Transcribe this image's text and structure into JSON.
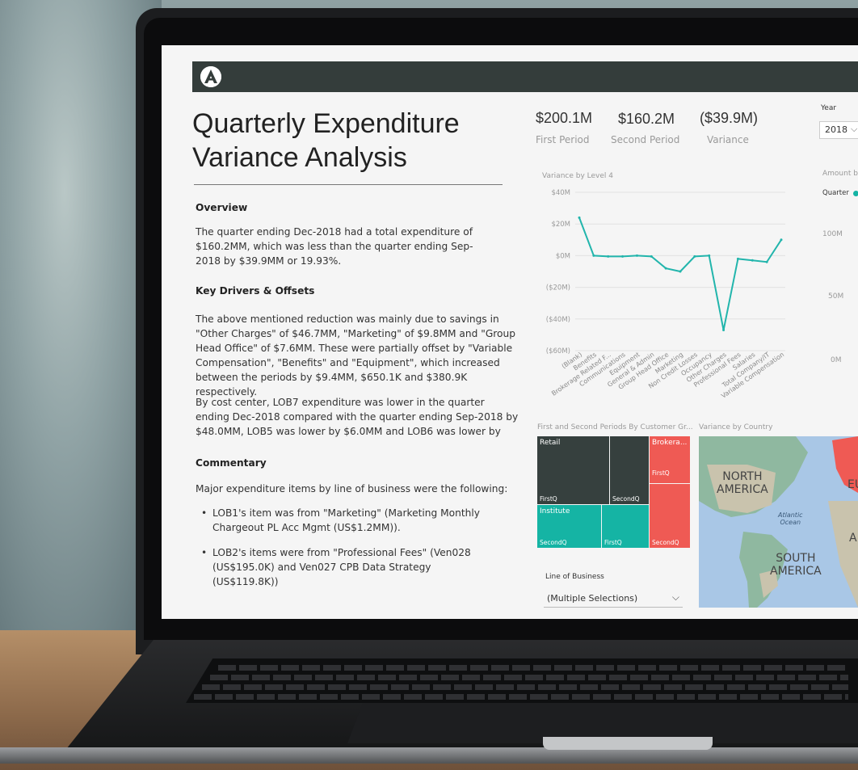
{
  "report": {
    "title_line1": "Quarterly Expenditure",
    "title_line2": "Variance Analysis",
    "overview_heading": "Overview",
    "overview_text": "The quarter ending Dec-2018 had a total expenditure of $160.2MM, which was less than the quarter ending Sep-2018 by $39.9MM or 19.93%.",
    "drivers_heading": "Key Drivers & Offsets",
    "drivers_text": "The above mentioned reduction was mainly due to savings in \"Other Charges\" of $46.7MM, \"Marketing\" of $9.8MM and \"Group Head Office\" of $7.6MM. These were partially offset by \"Variable Compensation\", \"Benefits\" and \"Equipment\", which increased between the periods by $9.4MM, $650.1K and $380.9K respectively.",
    "costcenter_text": "By cost center, LOB7 expenditure was lower in the quarter ending Dec-2018 compared with the quarter ending Sep-2018 by $48.0MM, LOB5 was lower by $6.0MM and LOB6 was lower by",
    "commentary_heading": "Commentary",
    "commentary_text": "Major expenditure items by line of business were the following:",
    "bullets": [
      "LOB1's item was from \"Marketing\" (Marketing Monthly Chargeout PL Acc Mgmt (US$1.2MM)).",
      "LOB2's items were from \"Professional Fees\" (Ven028 (US$195.0K) and Ven027 CPB Data Strategy (US$119.8K))"
    ]
  },
  "kpis": [
    {
      "value": "$200.1M",
      "label": "First Period"
    },
    {
      "value": "$160.2M",
      "label": "Second Period"
    },
    {
      "value": "($39.9M)",
      "label": "Variance"
    }
  ],
  "filters": {
    "year_label": "Year",
    "year_value": "2018",
    "line_of_business_label": "Line of Business",
    "line_of_business_value": "(Multiple Selections)"
  },
  "amount_chart": {
    "title": "Amount b",
    "legend_label": "Quarter",
    "y_ticks": [
      "100M",
      "50M",
      "0M"
    ]
  },
  "treemap": {
    "title": "First and Second Periods By Customer Gr...",
    "tiles": [
      {
        "name": "Retail",
        "sub": "FirstQ",
        "color": "#36403e"
      },
      {
        "name": "",
        "sub": "SecondQ",
        "color": "#36403e"
      },
      {
        "name": "Brokera...",
        "sub": "FirstQ",
        "color": "#ef5a54"
      },
      {
        "name": "",
        "sub": "SecondQ",
        "color": "#ef5a54"
      },
      {
        "name": "Institute",
        "sub": "SecondQ",
        "color": "#15b4a4"
      },
      {
        "name": "",
        "sub": "FirstQ",
        "color": "#15b4a4"
      }
    ]
  },
  "map": {
    "title": "Variance by Country",
    "labels": {
      "north_america": "NORTH\nAMERICA",
      "south_america": "SOUTH\nAMERICA",
      "atlantic": "Atlantic\nOcean",
      "eu": "EU",
      "a": "A"
    }
  },
  "chart_data": {
    "type": "line",
    "title": "Variance by Level 4",
    "categories": [
      "(Blank)",
      "Benefits",
      "Brokerage Related F...",
      "Communications",
      "Equipment",
      "General & Admin",
      "Group Head Office",
      "Marketing",
      "Non Credit Losses",
      "Occupancy",
      "Other Charges",
      "Professional Fees",
      "Salaries",
      "Total Company/IT",
      "Variable Compensation"
    ],
    "values": [
      24,
      0,
      -0.5,
      -0.5,
      0,
      -0.5,
      -8,
      -10,
      -0.5,
      0,
      -47,
      -2,
      -3,
      -4,
      10
    ],
    "y_ticks": [
      "$40M",
      "$20M",
      "$0M",
      "($20M)",
      "($40M)",
      "($60M)"
    ],
    "ylim": [
      -60,
      40
    ],
    "color": "#22b5ac",
    "grid": true
  }
}
